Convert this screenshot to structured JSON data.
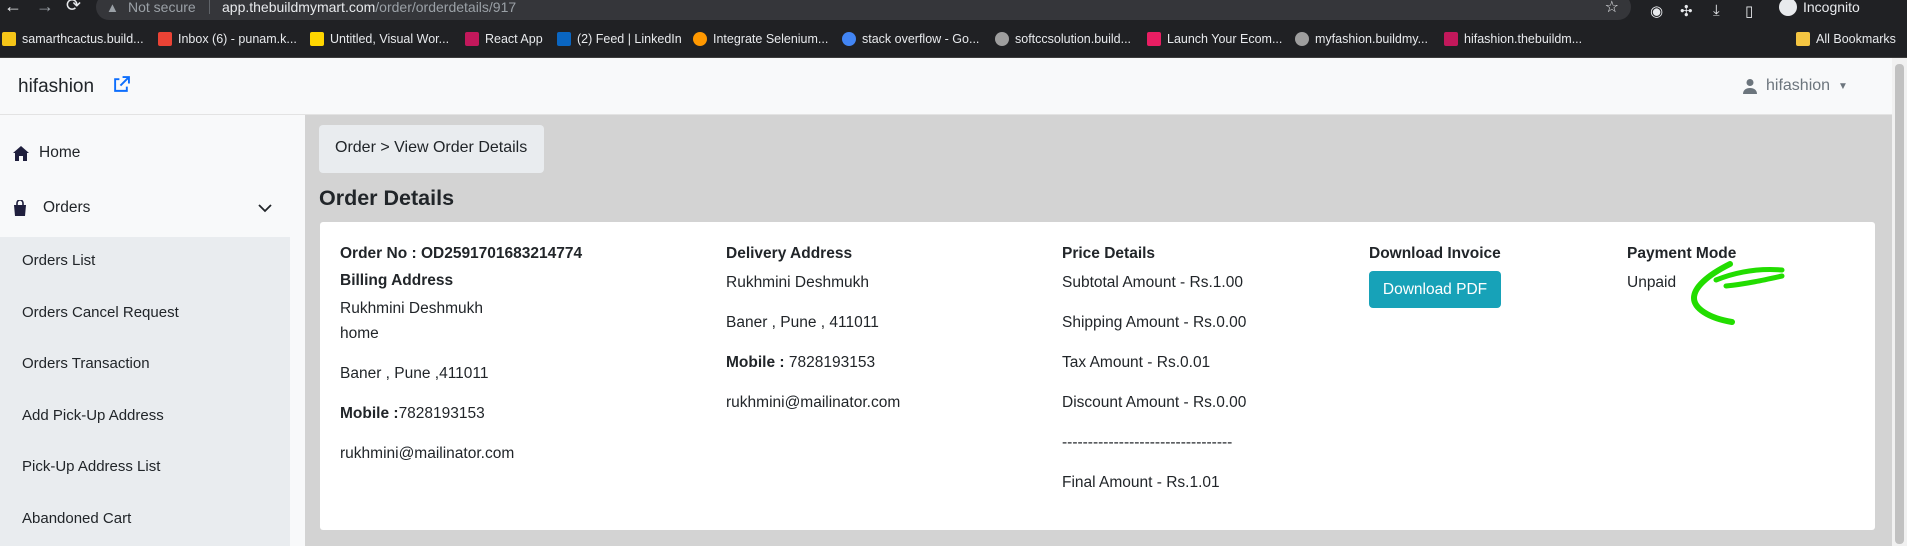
{
  "browser": {
    "not_secure": "Not secure",
    "url_host": "app.thebuildmymart.com",
    "url_path": "/order/orderdetails/917",
    "incognito": "Incognito",
    "bookmarks": [
      {
        "label": "samarthcactus.build...",
        "color": "#f5c518"
      },
      {
        "label": "Inbox (6) - punam.k...",
        "color": "#ea4335"
      },
      {
        "label": "Untitled, Visual Wor...",
        "color": "#ffd600"
      },
      {
        "label": "React App",
        "color": "#c2185b"
      },
      {
        "label": "(2) Feed | LinkedIn",
        "color": "#0a66c2"
      },
      {
        "label": "Integrate Selenium...",
        "color": "#ff9800"
      },
      {
        "label": "stack overflow - Go...",
        "color": "#4285f4"
      },
      {
        "label": "softccsolution.build...",
        "color": "#9e9e9e"
      },
      {
        "label": "Launch Your Ecom...",
        "color": "#e91e63"
      },
      {
        "label": "myfashion.buildmy...",
        "color": "#9e9e9e"
      },
      {
        "label": "hifashion.thebuildm...",
        "color": "#c2185b"
      }
    ],
    "all_bookmarks": "All Bookmarks"
  },
  "header": {
    "brand": "hifashion",
    "user": "hifashion"
  },
  "sidebar": {
    "home": "Home",
    "orders": "Orders",
    "sub_items": [
      "Orders List",
      "Orders Cancel Request",
      "Orders Transaction",
      "Add Pick-Up Address",
      "Pick-Up Address List",
      "Abandoned Cart"
    ]
  },
  "breadcrumb": "Order > View Order Details",
  "page_title": "Order Details",
  "order": {
    "order_no": "Order No : OD2591701683214774",
    "billing": {
      "heading": "Billing Address",
      "name": "Rukhmini Deshmukh",
      "type": "home",
      "address": "Baner , Pune ,411011",
      "mobile_label": "Mobile :",
      "mobile": "7828193153",
      "email": "rukhmini@mailinator.com"
    },
    "delivery": {
      "heading": "Delivery Address",
      "name": "Rukhmini Deshmukh",
      "address": "Baner , Pune , 411011",
      "mobile_label": "Mobile :",
      "mobile": " 7828193153",
      "email": "rukhmini@mailinator.com"
    },
    "price": {
      "heading": "Price Details",
      "subtotal": "Subtotal Amount - Rs.1.00",
      "shipping": "Shipping Amount - Rs.0.00",
      "tax": "Tax Amount - Rs.0.01",
      "discount": "Discount Amount - Rs.0.00",
      "divider": "---------------------------------",
      "final": "Final Amount - Rs.1.01"
    },
    "invoice": {
      "heading": "Download Invoice",
      "button": "Download PDF"
    },
    "payment": {
      "heading": "Payment Mode",
      "value": "Unpaid"
    }
  },
  "colors": {
    "accent": "#17a2b8",
    "annotation": "#22dd00"
  }
}
